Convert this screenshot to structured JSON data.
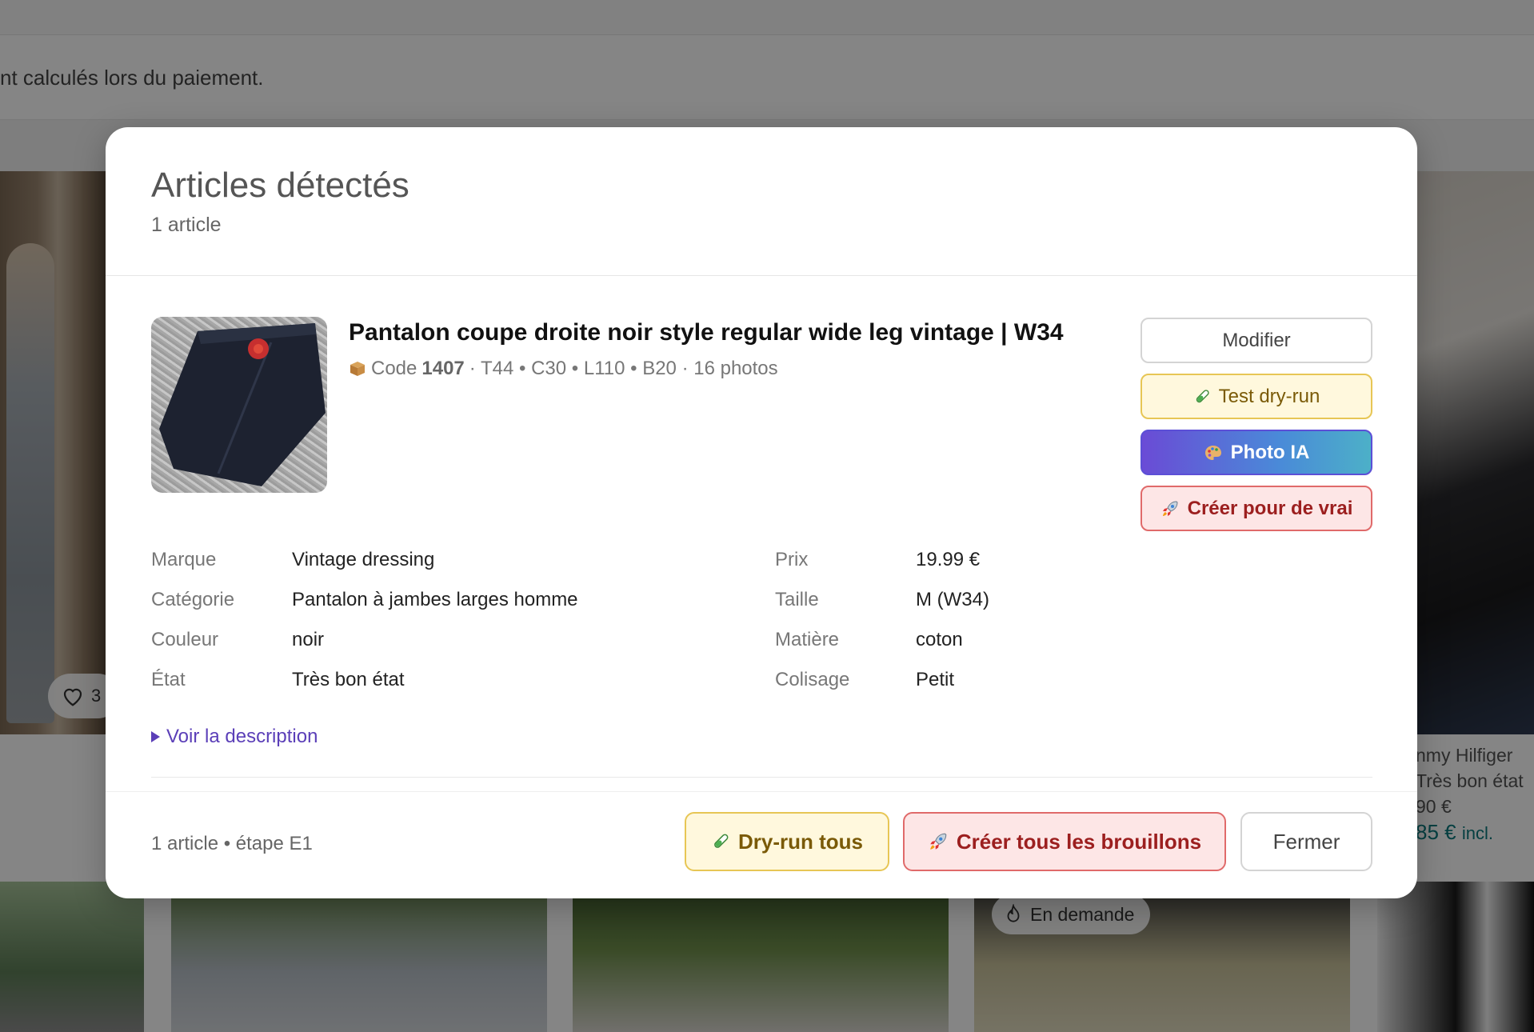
{
  "background": {
    "info_text": "nt calculés lors du paiement.",
    "like_count": "3",
    "right_card": {
      "brand": "nmy Hilfiger",
      "condition": "Très bon état",
      "price": "90 €",
      "price_incl": "85 €",
      "incl_label": "incl."
    },
    "demand_badge": "En demande"
  },
  "modal": {
    "title": "Articles détectés",
    "subtitle": "1 article",
    "item": {
      "title": "Pantalon coupe droite noir style regular wide leg vintage | W34",
      "code_prefix": "Code",
      "code": "1407",
      "meta_rest": "· T44 • C30 • L110 • B20 · 16 photos",
      "properties_left": [
        {
          "label": "Marque",
          "value": "Vintage dressing"
        },
        {
          "label": "Catégorie",
          "value": "Pantalon à jambes larges homme"
        },
        {
          "label": "Couleur",
          "value": "noir"
        },
        {
          "label": "État",
          "value": "Très bon état"
        }
      ],
      "properties_right": [
        {
          "label": "Prix",
          "value": "19.99 €"
        },
        {
          "label": "Taille",
          "value": "M (W34)"
        },
        {
          "label": "Matière",
          "value": "coton"
        },
        {
          "label": "Colisage",
          "value": "Petit"
        }
      ],
      "description_toggle": "Voir la description"
    },
    "actions": {
      "modify": "Modifier",
      "test_dry_run": "Test dry-run",
      "photo_ia": "Photo IA",
      "create_real": "Créer pour de vrai"
    },
    "footer": {
      "status": "1 article • étape E1",
      "dry_run_all": "Dry-run tous",
      "create_all": "Créer tous les brouillons",
      "close": "Fermer"
    }
  },
  "colors": {
    "accent_purple": "#5b3fb8",
    "warn_yellow": "#fff8dd",
    "danger_red": "#fde6e6",
    "gradient_start": "#6a4bd6",
    "gradient_end": "#4cb0c8"
  }
}
